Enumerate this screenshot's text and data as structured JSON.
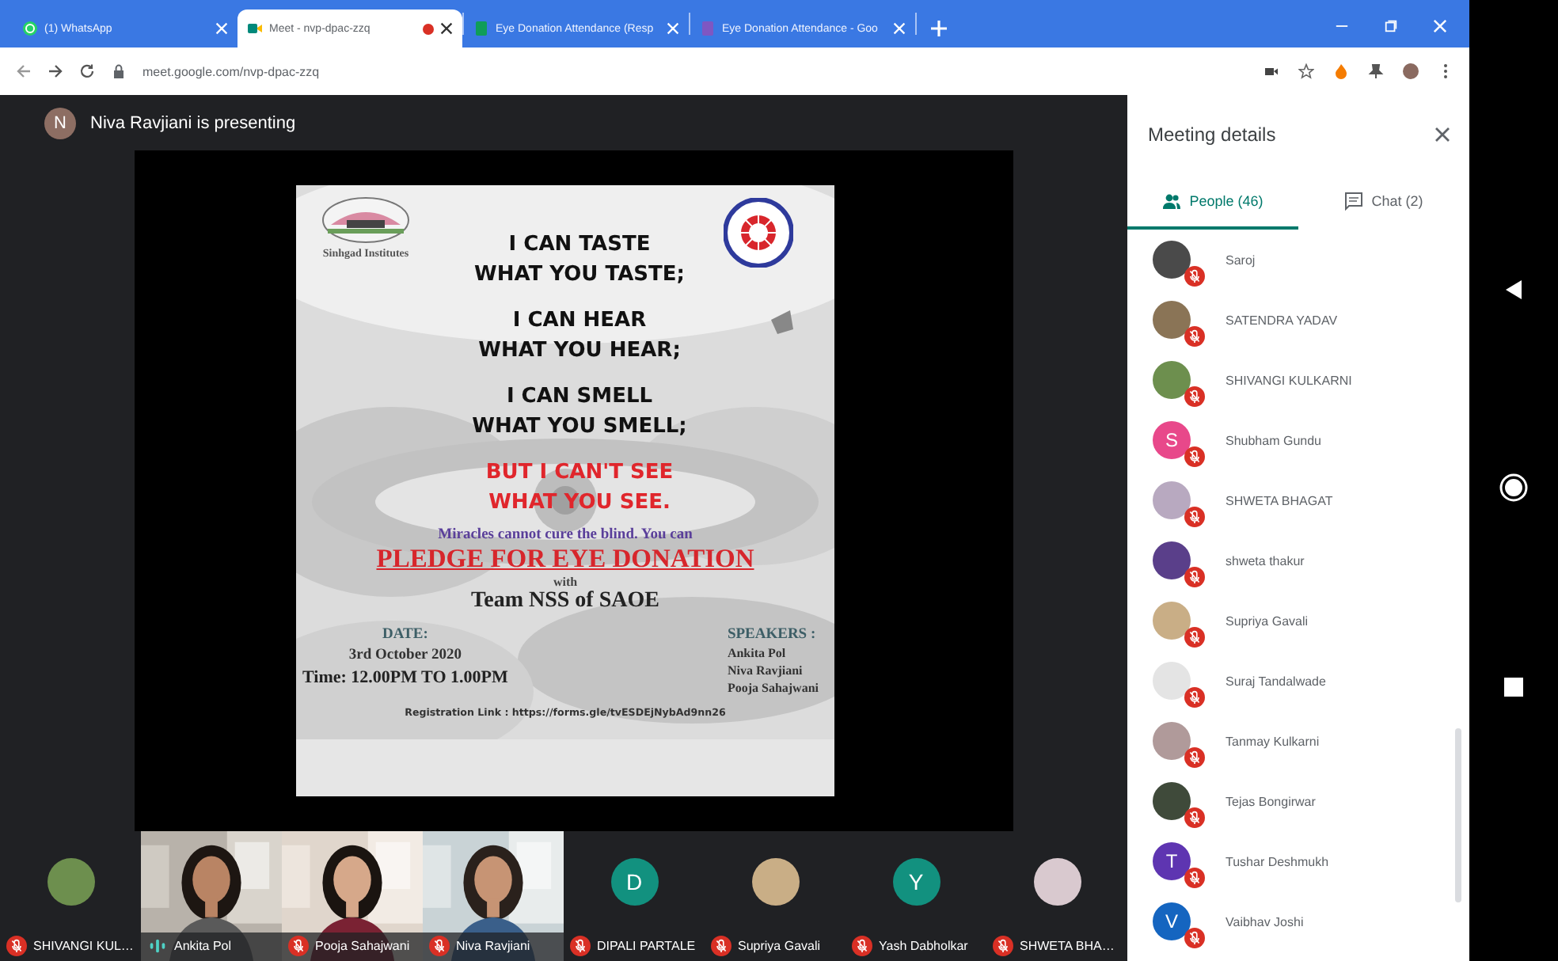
{
  "browser": {
    "tabs": [
      {
        "title": "(1) WhatsApp",
        "kind": "whatsapp",
        "selected": false,
        "recording": false
      },
      {
        "title": "Meet - nvp-dpac-zzq",
        "kind": "meet",
        "selected": true,
        "recording": true
      },
      {
        "title": "Eye Donation Attendance (Resp",
        "kind": "sheet",
        "selected": false,
        "recording": false
      },
      {
        "title": "Eye Donation Attendance - Goo",
        "kind": "form",
        "selected": false,
        "recording": false
      }
    ],
    "url": "meet.google.com/nvp-dpac-zzq"
  },
  "presenter": {
    "initial": "N",
    "text": "Niva Ravjiani is presenting"
  },
  "slide": {
    "logo_caption": "Sinhgad Institutes",
    "headings": [
      {
        "text": "I CAN TASTE",
        "kind": "black"
      },
      {
        "text": "WHAT YOU TASTE;",
        "kind": "black"
      },
      {
        "text": "I CAN HEAR",
        "kind": "black"
      },
      {
        "text": "WHAT YOU HEAR;",
        "kind": "black"
      },
      {
        "text": "I CAN SMELL",
        "kind": "black"
      },
      {
        "text": "WHAT YOU SMELL;",
        "kind": "black"
      },
      {
        "text": "BUT I CAN'T SEE",
        "kind": "red"
      },
      {
        "text": "WHAT YOU SEE.",
        "kind": "red"
      }
    ],
    "tagline": "Miracles cannot cure the blind. You can",
    "pledge": "PLEDGE FOR EYE DONATION",
    "with": "with",
    "team": "Team NSS of SAOE",
    "date_label": "DATE:",
    "date": "3rd October 2020",
    "time": "Time: 12.00PM TO 1.00PM",
    "speakers_label": "SPEAKERS :",
    "speakers": [
      "Ankita Pol",
      "Niva Ravjiani",
      "Pooja Sahajwani"
    ],
    "registration": "Registration Link : https://forms.gle/tvESDEjNybAd9nn26"
  },
  "tiles": [
    {
      "name": "SHIVANGI KUL…",
      "color": "#6d8f4e",
      "muted": true
    },
    {
      "name": "Ankita Pol",
      "kind": "video",
      "muted": false
    },
    {
      "name": "Pooja Sahajwani",
      "kind": "video",
      "muted": true
    },
    {
      "name": "Niva Ravjiani",
      "kind": "video",
      "muted": true
    },
    {
      "name": "DIPALI PARTALE",
      "kind": "letter",
      "initial": "D",
      "color": "#12917f",
      "muted": true
    },
    {
      "name": "Supriya Gavali",
      "color": "#c9ae86",
      "muted": true
    },
    {
      "name": "Yash Dabholkar",
      "kind": "letter",
      "initial": "Y",
      "color": "#12917f",
      "muted": true
    },
    {
      "name": "SHWETA BHA…",
      "color": "#d9c9cf",
      "muted": true
    }
  ],
  "panel": {
    "title": "Meeting details",
    "tabs": [
      {
        "label": "People (46)",
        "kind": "people",
        "selected": true
      },
      {
        "label": "Chat (2)",
        "kind": "chat",
        "selected": false
      }
    ],
    "people": [
      {
        "name": "Saroj",
        "color": "#4a4a4a",
        "muted": true
      },
      {
        "name": "SATENDRA YADAV",
        "color": "#8a7456",
        "muted": true
      },
      {
        "name": "SHIVANGI KULKARNI",
        "color": "#6d8f4e",
        "muted": true
      },
      {
        "name": "Shubham Gundu",
        "kind": "letter",
        "initial": "S",
        "color": "#e8488a",
        "muted": true
      },
      {
        "name": "SHWETA BHAGAT",
        "color": "#b8a9c0",
        "muted": true
      },
      {
        "name": "shweta thakur",
        "color": "#5a3f8a",
        "muted": true
      },
      {
        "name": "Supriya Gavali",
        "color": "#c9ae86",
        "muted": true
      },
      {
        "name": "Suraj Tandalwade",
        "color": "#e4e4e4",
        "muted": true
      },
      {
        "name": "Tanmay Kulkarni",
        "color": "#b09a9a",
        "muted": true
      },
      {
        "name": "Tejas Bongirwar",
        "color": "#3f4a3a",
        "muted": true
      },
      {
        "name": "Tushar Deshmukh",
        "kind": "letter",
        "initial": "T",
        "color": "#5e35b1",
        "muted": true
      },
      {
        "name": "Vaibhav Joshi",
        "kind": "letter",
        "initial": "V",
        "color": "#1565c0",
        "muted": true
      }
    ]
  }
}
